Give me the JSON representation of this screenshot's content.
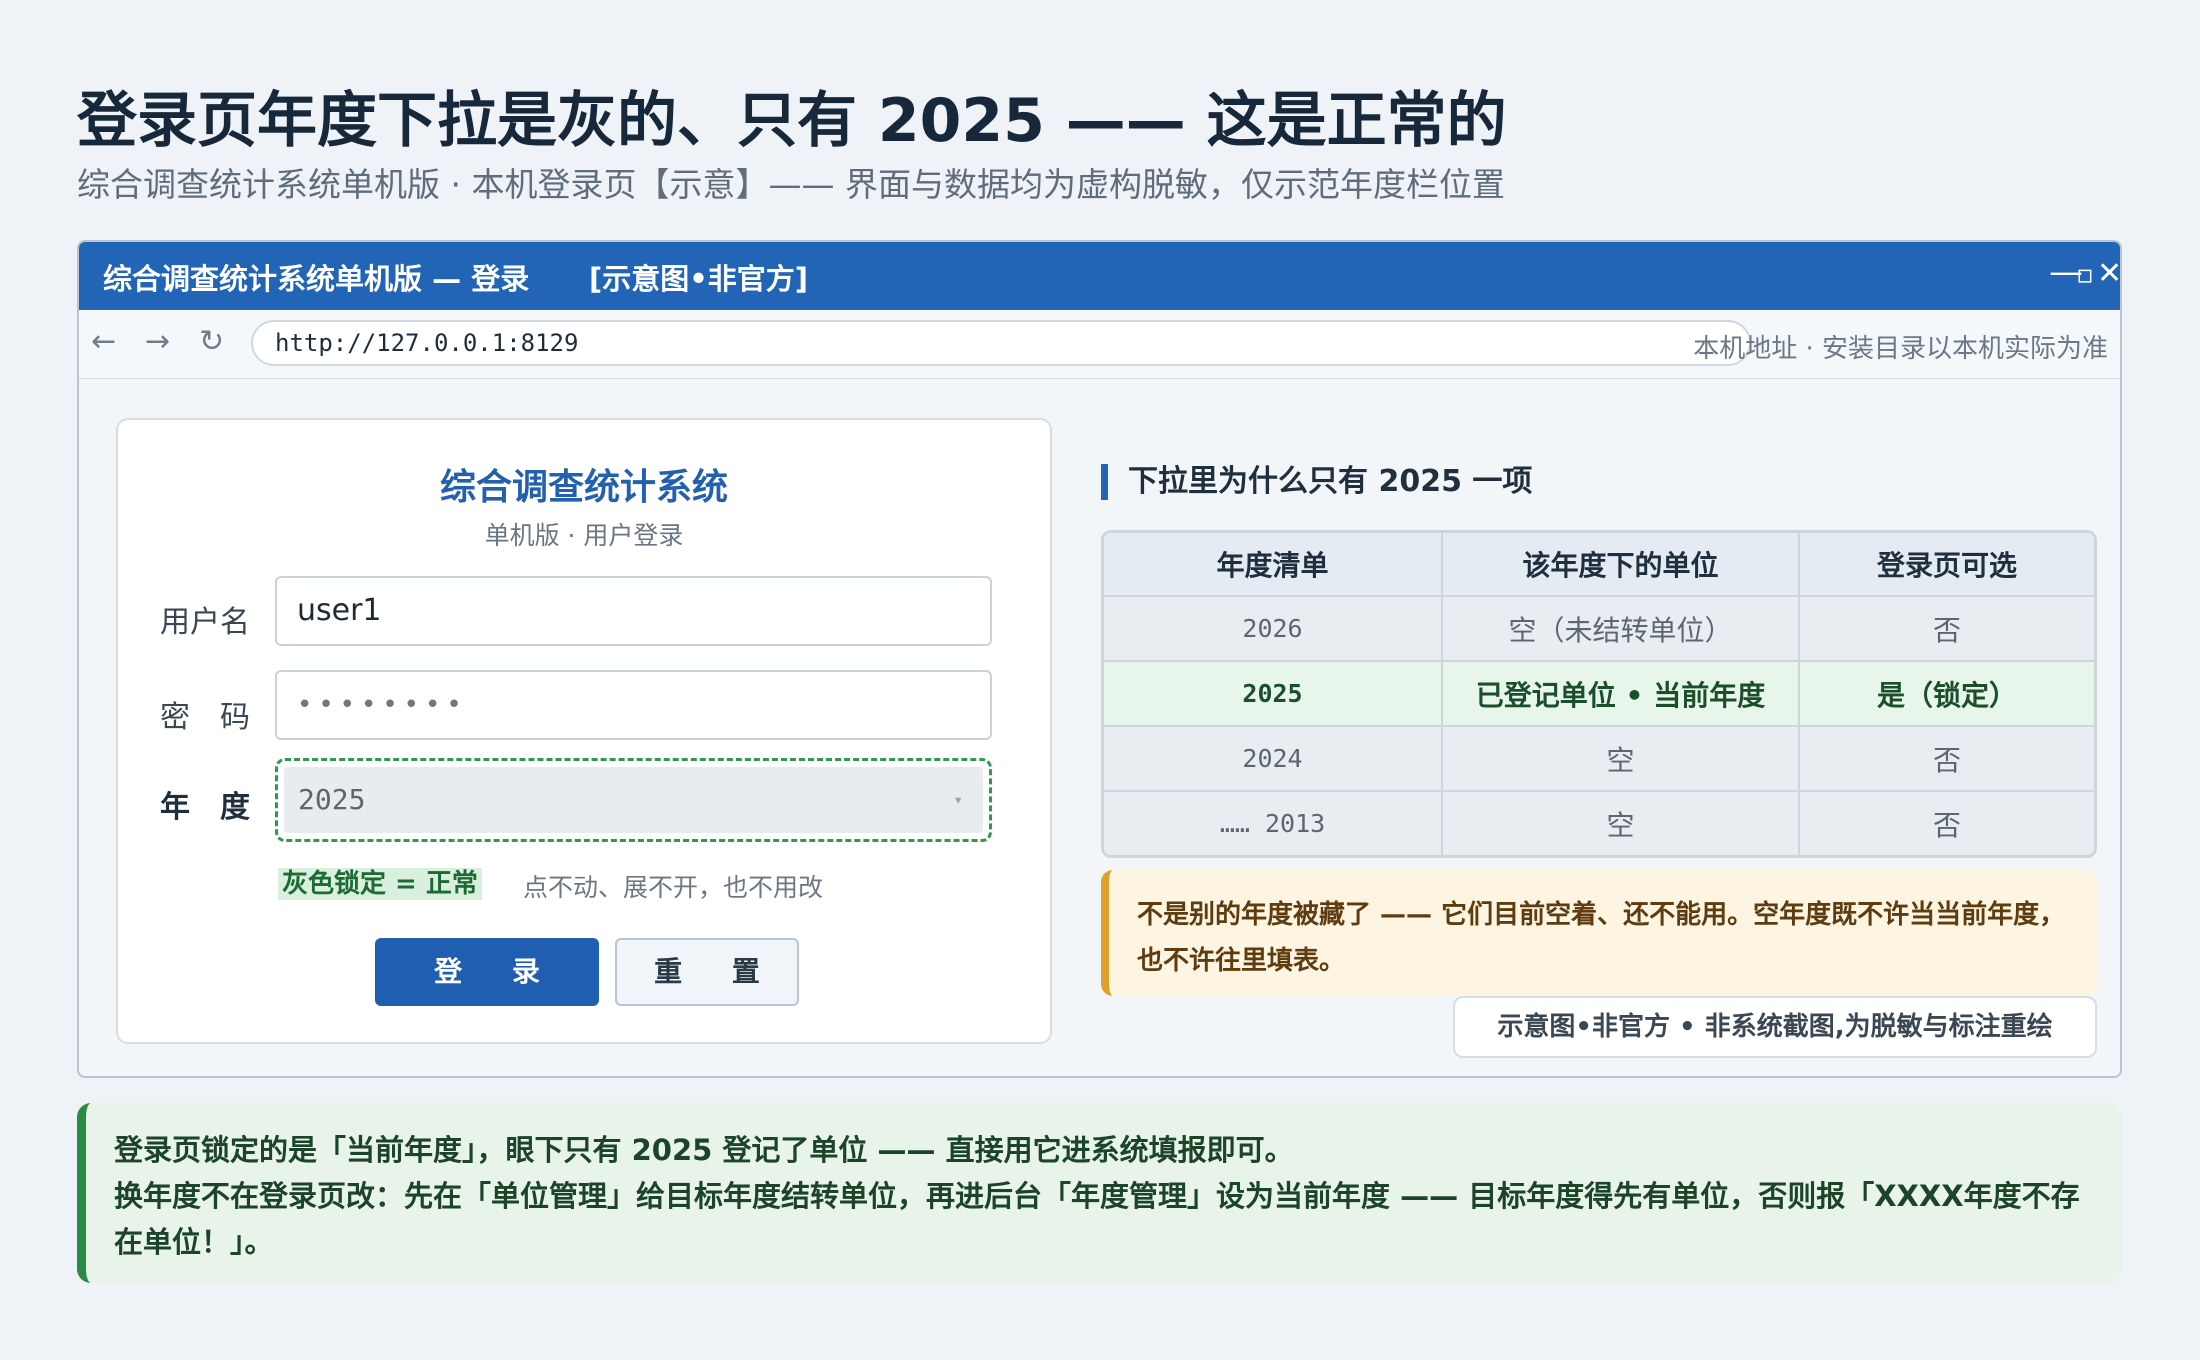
{
  "header": {
    "title": "登录页年度下拉是灰的、只有 2025 —— 这是正常的",
    "subtitle": "综合调查统计系统单机版 · 本机登录页【示意】—— 界面与数据均为虚构脱敏，仅示范年度栏位置"
  },
  "window": {
    "title": "综合调查统计系统单机版 — 登录",
    "tag": "[示意图•非官方]",
    "controls": {
      "minimize": "—",
      "maximize": "▫",
      "close": "✕"
    },
    "nav": {
      "back": "←",
      "forward": "→",
      "reload": "↻"
    },
    "url": "http://127.0.0.1:8129",
    "address_note": "本机地址 · 安装目录以本机实际为准"
  },
  "login": {
    "app_name": "综合调查统计系统",
    "app_sub": "单机版 · 用户登录",
    "username_label": "用户名",
    "username_value": "user1",
    "password_label": "密　码",
    "password_value": "••••••••",
    "year_label": "年　度",
    "year_value": "2025",
    "select_caret": "▾",
    "lock_badge": "灰色锁定 = 正常",
    "lock_note": "点不动、展不开，也不用改",
    "login_button": "登 录",
    "reset_button": "重 置"
  },
  "explain": {
    "title": "下拉里为什么只有 2025 一项",
    "columns": [
      "年度清单",
      "该年度下的单位",
      "登录页可选"
    ],
    "rows": [
      {
        "year": "2026",
        "units": "空（未结转单位）",
        "selectable": "否"
      },
      {
        "year": "2025",
        "units": "已登记单位 • 当前年度",
        "selectable": "是（锁定）"
      },
      {
        "year": "2024",
        "units": "空",
        "selectable": "否"
      },
      {
        "year": "…… 2013",
        "units": "空",
        "selectable": "否"
      }
    ],
    "warning": "不是别的年度被藏了 —— 它们目前空着、还不能用。空年度既不许当当前年度，也不许往里填表。",
    "disclaimer": "示意图•非官方 • 非系统截图,为脱敏与标注重绘"
  },
  "footer_note": {
    "line1": "登录页锁定的是「当前年度」，眼下只有 2025 登记了单位 —— 直接用它进系统填报即可。",
    "line2": "换年度不在登录页改：先在「单位管理」给目标年度结转单位，再进后台「年度管理」设为当前年度 —— 目标年度得先有单位，否则报「XXXX年度不存在单位！」。"
  },
  "colors": {
    "titlebar": "#2264b5",
    "locked_border": "#2f9a4c",
    "warning_accent": "#e0a02e",
    "note_accent": "#2b8a45"
  }
}
